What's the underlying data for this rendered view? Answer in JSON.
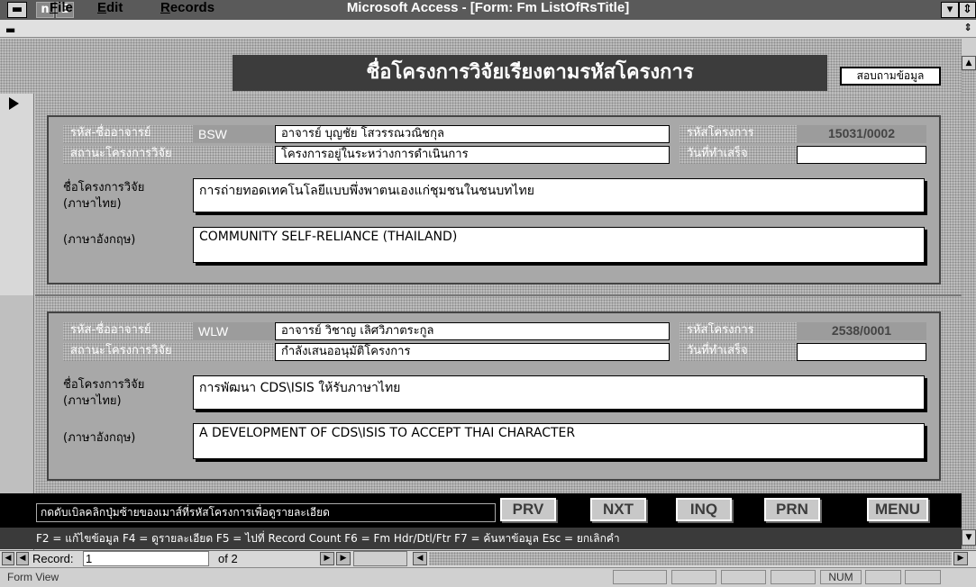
{
  "window": {
    "title": "Microsoft Access - [Form: Fm ListOfRsTitle]",
    "sys_glyph_1": "▬",
    "sys_glyph_2": "▬",
    "mdi_glyph": "E"
  },
  "menu": [
    {
      "key": "F",
      "rest": "ile"
    },
    {
      "key": "E",
      "rest": "dit"
    },
    {
      "key": "R",
      "rest": "ecords"
    }
  ],
  "form": {
    "heading": "ชื่อโครงการวิจัยเรียงตามรหัสโครงการ",
    "search_button": "สอบถามข้อมูล",
    "records": [
      {
        "label_researcher_code": "รหัส-ชื่ออาจารย์",
        "researcher_code": "BSW",
        "researcher_name": "อาจารย์ บุญชัย โสวรรณวณิชกุล",
        "label_project_code": "รหัสโครงการ",
        "project_code": "15031/0002",
        "label_status": "สถานะโครงการวิจัย",
        "status": "โครงการอยู่ในระหว่างการดำเนินการ",
        "label_finish": "วันที่ทำเสร็จ",
        "finish": "",
        "label_title_th_1": "ชื่อโครงการวิจัย",
        "label_title_th_2": "(ภาษาไทย)",
        "title_th": "การถ่ายทอดเทคโนโลยีแบบพึ่งพาตนเองแก่ชุมชนในชนบทไทย",
        "label_title_en": "(ภาษาอังกฤษ)",
        "title_en": "COMMUNITY SELF-RELIANCE (THAILAND)"
      },
      {
        "label_researcher_code": "รหัส-ชื่ออาจารย์",
        "researcher_code": "WLW",
        "researcher_name": "อาจารย์ วิชาญ เลิศวิภาตระกูล",
        "label_project_code": "รหัสโครงการ",
        "project_code": "2538/0001",
        "label_status": "สถานะโครงการวิจัย",
        "status": "กำลังเสนออนุมัติโครงการ",
        "label_finish": "วันที่ทำเสร็จ",
        "finish": "",
        "label_title_th_1": "ชื่อโครงการวิจัย",
        "label_title_th_2": "(ภาษาไทย)",
        "title_th": "การพัฒนา CDS\\ISIS ให้รับภาษาไทย",
        "label_title_en": "(ภาษาอังกฤษ)",
        "title_en": "A DEVELOPMENT OF CDS\\ISIS TO ACCEPT THAI CHARACTER"
      }
    ],
    "hint": "กดดับเบิลคลิกปุ่มซ้ายของเมาส์ที่รหัสโครงการเพื่อดูรายละเอียด",
    "buttons": {
      "prv": "PRV",
      "nxt": "NXT",
      "inq": "INQ",
      "prn": "PRN",
      "menu": "MENU"
    },
    "keys": "F2 = แก้ไขข้อมูล    F4 = ดูรายละเอียด    F5 = ไปที่ Record Count    F6 = Fm Hdr/Dtl/Ftr    F7 = ค้นหาข้อมูล    Esc = ยกเลิกคำ"
  },
  "navigator": {
    "record_label": "Record:",
    "current": "1",
    "of_label": "of 2"
  },
  "status": {
    "mode": "Form View",
    "num": "NUM"
  },
  "colors": {
    "heading_bg": "#3c3c3c",
    "panel_bg": "#a8a8a8",
    "titlebar_bg": "#5a5a5a"
  },
  "icons": [
    "system-menu-icon",
    "first-record-icon",
    "prev-record-icon",
    "next-record-icon",
    "last-record-icon",
    "new-record-icon",
    "scroll-left-icon",
    "scroll-right-icon",
    "scroll-up-icon",
    "scroll-down-icon",
    "minimize-icon",
    "restore-icon"
  ]
}
